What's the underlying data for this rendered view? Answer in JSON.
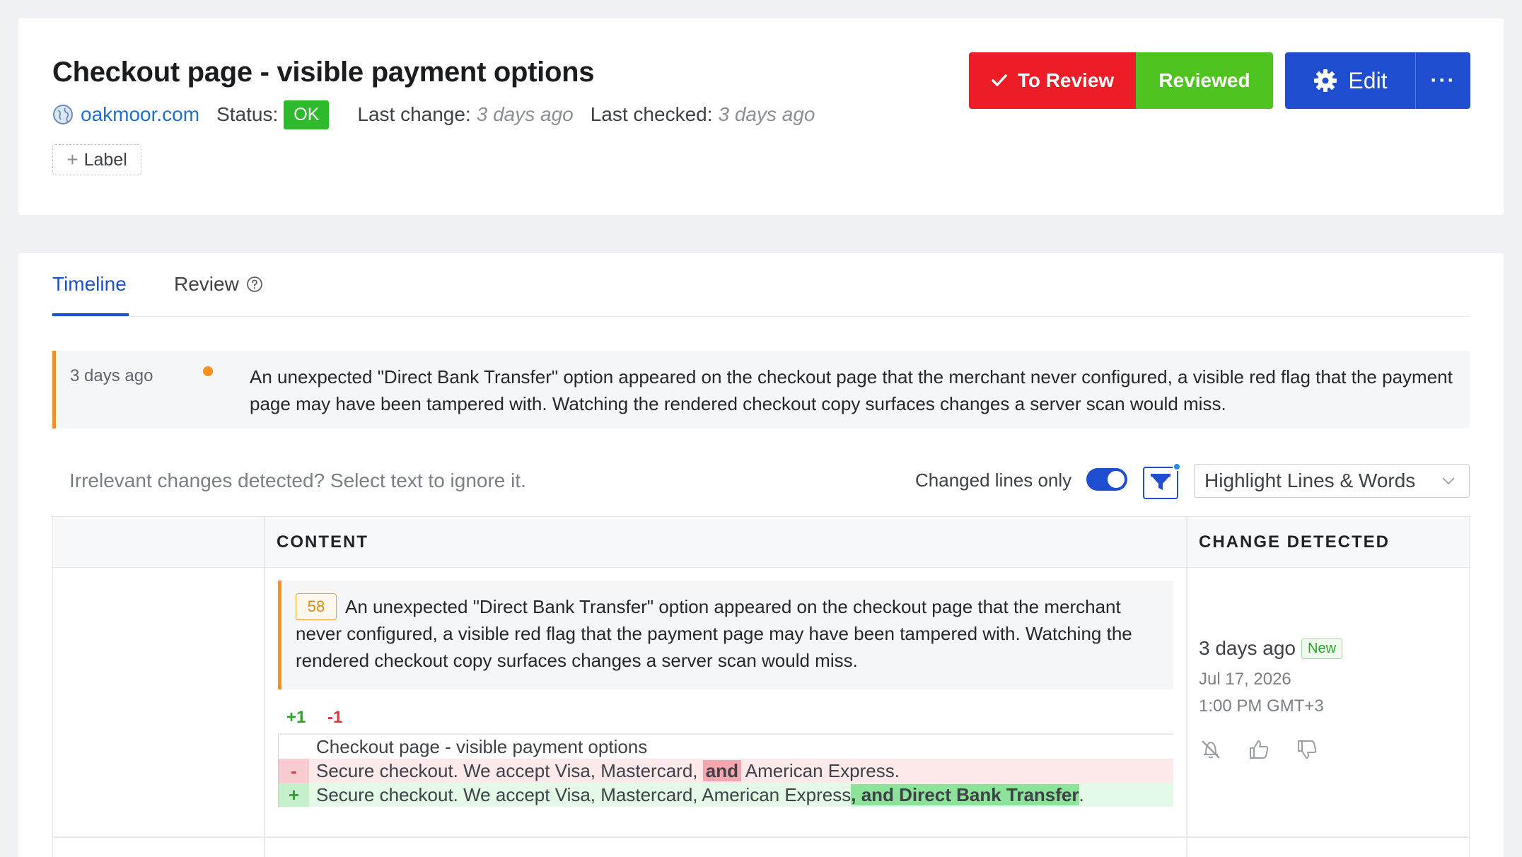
{
  "header": {
    "title": "Checkout page - visible payment options",
    "site": "oakmoor.com",
    "status_label": "Status:",
    "status_value": "OK",
    "last_change_label": "Last change:",
    "last_change_value": "3 days ago",
    "last_checked_label": "Last checked:",
    "last_checked_value": "3 days ago",
    "label_button": "Label",
    "to_review_label": "To Review",
    "reviewed_label": "Reviewed",
    "edit_label": "Edit",
    "more_label": "···"
  },
  "tabs": [
    {
      "label": "Timeline",
      "active": true
    },
    {
      "label": "Review",
      "active": false
    }
  ],
  "timeline": {
    "time": "3 days ago",
    "text": "An unexpected \"Direct Bank Transfer\" option appeared on the checkout page that the merchant never configured, a visible red flag that the payment page may have been tampered with. Watching the rendered checkout copy surfaces changes a server scan would miss."
  },
  "toolbar": {
    "hint": "Irrelevant changes detected? Select text to ignore it.",
    "changed_lines_label": "Changed lines only",
    "changed_lines_on": true,
    "highlight_mode": "Highlight Lines & Words"
  },
  "table": {
    "col_content": "CONTENT",
    "col_change": "CHANGE DETECTED",
    "row": {
      "note_number": "58",
      "note_text": "An unexpected \"Direct Bank Transfer\" option appeared on the checkout page that the merchant never configured, a visible red flag that the payment page may have been tampered with. Watching the rendered checkout copy surfaces changes a server scan would miss.",
      "added_count": "+1",
      "removed_count": "-1",
      "context_line": "Checkout page - visible payment options",
      "removed_marker": "-",
      "removed_prefix": "Secure checkout. We accept Visa, Mastercard, ",
      "removed_word": "and",
      "removed_suffix": " American Express.",
      "added_marker": "+",
      "added_prefix": "Secure checkout. We accept Visa, Mastercard, American Express",
      "added_word": ", and Direct Bank Transfer",
      "added_suffix": ".",
      "change_ago": "3 days ago",
      "new_badge": "New",
      "change_date": "Jul 17, 2026",
      "change_time": "1:00 PM GMT+3"
    }
  },
  "colors": {
    "primary": "#1f4fd0",
    "danger": "#ec1d26",
    "success": "#4fc31f",
    "accent_orange": "#f5921f"
  },
  "icons": [
    "globe-icon",
    "check-icon",
    "gear-icon",
    "help-icon",
    "filter-icon",
    "chevron-down-icon",
    "mute-icon",
    "thumbs-up-icon",
    "thumbs-down-icon"
  ]
}
